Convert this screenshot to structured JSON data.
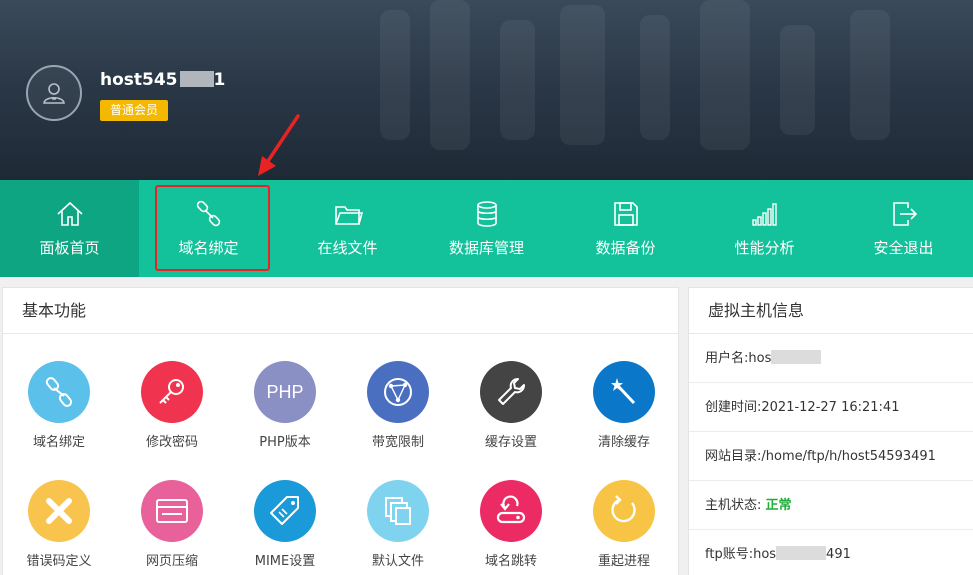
{
  "user": {
    "name_visible": "host545",
    "name_trail": "1",
    "badge": "普通会员"
  },
  "nav": {
    "items": [
      {
        "label": "面板首页",
        "icon": "home-icon"
      },
      {
        "label": "域名绑定",
        "icon": "link-icon"
      },
      {
        "label": "在线文件",
        "icon": "folder-icon"
      },
      {
        "label": "数据库管理",
        "icon": "database-icon"
      },
      {
        "label": "数据备份",
        "icon": "save-icon"
      },
      {
        "label": "性能分析",
        "icon": "signal-bars-icon"
      },
      {
        "label": "安全退出",
        "icon": "logout-icon"
      }
    ]
  },
  "basic": {
    "title": "基本功能",
    "items": [
      {
        "label": "域名绑定",
        "icon": "link-icon",
        "color": "#5bc0ea"
      },
      {
        "label": "修改密码",
        "icon": "key-icon",
        "color": "#f0344f"
      },
      {
        "label": "PHP版本",
        "icon": "php-icon",
        "color": "#8a8fc4",
        "icon_text": "PHP"
      },
      {
        "label": "带宽限制",
        "icon": "globe-icon",
        "color": "#4a6fc1"
      },
      {
        "label": "缓存设置",
        "icon": "wrench-icon",
        "color": "#444444"
      },
      {
        "label": "清除缓存",
        "icon": "magic-wand-icon",
        "color": "#0a77c9"
      },
      {
        "label": "错误码定义",
        "icon": "close-icon",
        "color": "#f8c44e"
      },
      {
        "label": "网页压缩",
        "icon": "card-icon",
        "color": "#e8619a"
      },
      {
        "label": "MIME设置",
        "icon": "tag-icon",
        "color": "#1a9ad8"
      },
      {
        "label": "默认文件",
        "icon": "files-icon",
        "color": "#7fd3ee"
      },
      {
        "label": "域名跳转",
        "icon": "redirect-icon",
        "color": "#ec2a64"
      },
      {
        "label": "重起进程",
        "icon": "restart-icon",
        "color": "#f7c445"
      }
    ]
  },
  "info": {
    "title": "虚拟主机信息",
    "username_label": "用户名:",
    "username_visible": "hos",
    "created_label": "创建时间:",
    "created_value": "2021-12-27 16:21:41",
    "webroot_label": "网站目录:",
    "webroot_value": "/home/ftp/h/host54593491",
    "status_label": "主机状态:",
    "status_value": "正常",
    "ftp_label": "ftp账号:",
    "ftp_visible": "hos",
    "ftp_trail": "491"
  },
  "colors": {
    "nav_bg": "#13c19a",
    "nav_active": "#0ea583",
    "badge": "#f5b800",
    "highlight": "#e82323",
    "status_ok": "#1fae3a"
  }
}
